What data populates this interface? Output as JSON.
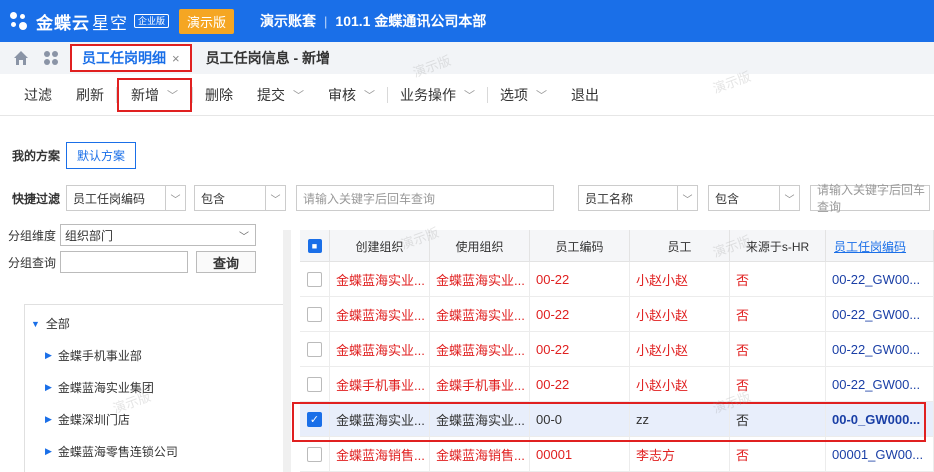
{
  "topbar": {
    "brand": "金蝶云",
    "brand_thin": "星空",
    "edition": "企业版",
    "demo_badge": "演示版",
    "account": "演示账套",
    "separator": "|",
    "company": "101.1 金蝶通讯公司本部"
  },
  "tabs": {
    "active": "员工任岗明细",
    "close": "×",
    "second": "员工任岗信息 - 新增"
  },
  "toolbar": {
    "items": [
      {
        "label": "过滤",
        "caret": false
      },
      {
        "label": "刷新",
        "caret": false
      },
      {
        "label": "新增",
        "caret": true
      },
      {
        "label": "删除",
        "caret": false
      },
      {
        "label": "提交",
        "caret": true
      },
      {
        "label": "审核",
        "caret": true
      },
      {
        "label": "业务操作",
        "caret": true
      },
      {
        "label": "选项",
        "caret": true
      },
      {
        "label": "退出",
        "caret": false
      }
    ]
  },
  "scheme": {
    "label": "我的方案",
    "default_button": "默认方案"
  },
  "filter": {
    "label": "快捷过滤",
    "field1": "员工任岗编码",
    "op1": "包含",
    "placeholder1": "请输入关键字后回车查询",
    "field2": "员工名称",
    "op2": "包含",
    "placeholder2": "请输入关键字后回车查询"
  },
  "left_panel": {
    "group_dim_label": "分组维度",
    "group_dim_value": "组织部门",
    "group_query_label": "分组查询",
    "query_button": "查询",
    "tree": [
      "全部",
      "金蝶手机事业部",
      "金蝶蓝海实业集团",
      "金蝶深圳门店",
      "金蝶蓝海零售连锁公司"
    ]
  },
  "grid": {
    "columns": [
      "创建组织",
      "使用组织",
      "员工编码",
      "员工",
      "来源于s-HR",
      "员工任岗编码"
    ],
    "rows": [
      {
        "c1": "金蝶蓝海实业...",
        "c2": "金蝶蓝海实业...",
        "c3": "00-22",
        "c4": "小赵小赵",
        "c5": "否",
        "c6": "00-22_GW00...",
        "style": "red",
        "checked": false
      },
      {
        "c1": "金蝶蓝海实业...",
        "c2": "金蝶蓝海实业...",
        "c3": "00-22",
        "c4": "小赵小赵",
        "c5": "否",
        "c6": "00-22_GW00...",
        "style": "red",
        "checked": false
      },
      {
        "c1": "金蝶蓝海实业...",
        "c2": "金蝶蓝海实业...",
        "c3": "00-22",
        "c4": "小赵小赵",
        "c5": "否",
        "c6": "00-22_GW00...",
        "style": "red",
        "checked": false
      },
      {
        "c1": "金蝶手机事业...",
        "c2": "金蝶手机事业...",
        "c3": "00-22",
        "c4": "小赵小赵",
        "c5": "否",
        "c6": "00-22_GW00...",
        "style": "red",
        "checked": false
      },
      {
        "c1": "金蝶蓝海实业...",
        "c2": "金蝶蓝海实业...",
        "c3": "00-0",
        "c4": "zz",
        "c5": "否",
        "c6": "00-0_GW000...",
        "style": "dark",
        "checked": true
      },
      {
        "c1": "金蝶蓝海销售...",
        "c2": "金蝶蓝海销售...",
        "c3": "00001",
        "c4": "李志方",
        "c5": "否",
        "c6": "00001_GW00...",
        "style": "red",
        "checked": false
      }
    ]
  },
  "watermark": "演示版"
}
